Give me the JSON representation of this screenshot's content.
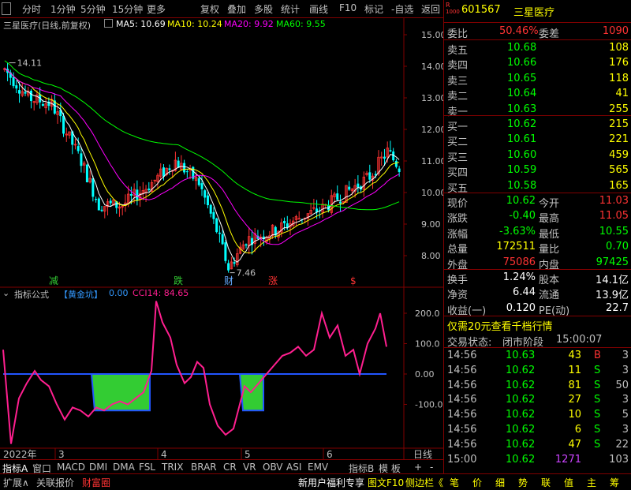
{
  "toolbar": {
    "left": [
      "分时",
      "1分钟",
      "5分钟",
      "15分钟",
      "更多"
    ],
    "right": [
      "复权",
      "叠加",
      "多股",
      "统计",
      "画线",
      "F10",
      "标记",
      "-自选",
      "返回"
    ]
  },
  "main": {
    "title": "三星医疗(日线,前复权)",
    "ma5": "MA5: 10.69",
    "ma10": "MA10: 10.24",
    "ma20": "MA20: 9.92",
    "ma60": "MA60: 9.55",
    "high_label": "14.11",
    "low_label": "7.46",
    "y_ticks": [
      "15.00",
      "14.00",
      "13.00",
      "12.00",
      "11.00",
      "10.00",
      "9.00",
      "8.00"
    ],
    "markers": [
      "减",
      "跌",
      "财",
      "涨",
      "$"
    ]
  },
  "indicator": {
    "title": "指标公式",
    "name": "【黄金坑】",
    "val1": "0.00",
    "cci": "CCI14: 84.65",
    "y_ticks": [
      "200.0",
      "100.0",
      "0.00",
      "-100.0"
    ]
  },
  "xaxis": {
    "year": "2022年",
    "months": [
      "3",
      "4",
      "5",
      "6"
    ],
    "right_label": "日线"
  },
  "tabs": [
    "指标A",
    "窗口",
    "MACD",
    "DMI",
    "DMA",
    "FSL",
    "TRIX",
    "BRAR",
    "CR",
    "VR",
    "OBV",
    "ASI",
    "EMV",
    "指标B",
    "模 板",
    "+",
    "-"
  ],
  "bottom": {
    "left": [
      "扩展∧",
      "关联报价",
      "财富圈"
    ],
    "middle": [
      "新用户福利专享",
      "图文F10",
      "侧边栏《"
    ],
    "right": [
      "笔",
      "价",
      "细",
      "势",
      "联",
      "值",
      "主",
      "筹"
    ]
  },
  "stock": {
    "r_badge": "R",
    "code": "601567",
    "name": "三星医疗"
  },
  "weibi": {
    "label": "委比",
    "value": "50.46%",
    "label2": "委差",
    "value2": "1090"
  },
  "sell": [
    {
      "label": "卖五",
      "price": "10.68",
      "vol": "108"
    },
    {
      "label": "卖四",
      "price": "10.66",
      "vol": "176"
    },
    {
      "label": "卖三",
      "price": "10.65",
      "vol": "118"
    },
    {
      "label": "卖二",
      "price": "10.64",
      "vol": "41"
    },
    {
      "label": "卖一",
      "price": "10.63",
      "vol": "255"
    }
  ],
  "buy": [
    {
      "label": "买一",
      "price": "10.62",
      "vol": "215"
    },
    {
      "label": "买二",
      "price": "10.61",
      "vol": "221"
    },
    {
      "label": "买三",
      "price": "10.60",
      "vol": "459"
    },
    {
      "label": "买四",
      "price": "10.59",
      "vol": "565"
    },
    {
      "label": "买五",
      "price": "10.58",
      "vol": "165"
    }
  ],
  "quote": [
    {
      "l1": "现价",
      "v1": "10.62",
      "l2": "今开",
      "v2": "11.03",
      "c1": "#00ff00",
      "c2": "#ff3333"
    },
    {
      "l1": "涨跌",
      "v1": "-0.40",
      "l2": "最高",
      "v2": "11.05",
      "c1": "#00ff00",
      "c2": "#ff3333"
    },
    {
      "l1": "涨幅",
      "v1": "-3.63%",
      "l2": "最低",
      "v2": "10.55",
      "c1": "#00ff00",
      "c2": "#00ff00"
    },
    {
      "l1": "总量",
      "v1": "172511",
      "l2": "量比",
      "v2": "0.70",
      "c1": "#ffff00",
      "c2": "#00ff00"
    },
    {
      "l1": "外盘",
      "v1": "75086",
      "l2": "内盘",
      "v2": "97425",
      "c1": "#ff3333",
      "c2": "#00ff00"
    }
  ],
  "stats": [
    {
      "l1": "换手",
      "v1": "1.24%",
      "l2": "股本",
      "v2": "14.1亿"
    },
    {
      "l1": "净资",
      "v1": "6.44",
      "l2": "流通",
      "v2": "13.9亿"
    },
    {
      "l1": "收益(一)",
      "v1": "0.120",
      "l2": "PE(动)",
      "v2": "22.7"
    }
  ],
  "promo": "仅需20元查看千档行情",
  "status": {
    "label": "交易状态:",
    "value": "闭市阶段",
    "time": "15:00:07"
  },
  "trades": [
    {
      "time": "14:56",
      "price": "10.63",
      "vol": "43",
      "bs": "B",
      "n": "3"
    },
    {
      "time": "14:56",
      "price": "10.62",
      "vol": "11",
      "bs": "S",
      "n": "3"
    },
    {
      "time": "14:56",
      "price": "10.62",
      "vol": "81",
      "bs": "S",
      "n": "50"
    },
    {
      "time": "14:56",
      "price": "10.62",
      "vol": "27",
      "bs": "S",
      "n": "3"
    },
    {
      "time": "14:56",
      "price": "10.62",
      "vol": "10",
      "bs": "S",
      "n": "5"
    },
    {
      "time": "14:56",
      "price": "10.62",
      "vol": "6",
      "bs": "S",
      "n": "3"
    },
    {
      "time": "14:56",
      "price": "10.62",
      "vol": "47",
      "bs": "S",
      "n": "22"
    },
    {
      "time": "15:00",
      "price": "10.62",
      "vol": "1271",
      "bs": "",
      "n": "103"
    }
  ],
  "colors": {
    "up": "#ff3333",
    "down": "#00ffff",
    "ma5": "#ffffff",
    "ma10": "#ffff00",
    "ma20": "#ff00ff",
    "ma60": "#00ff00",
    "cci": "#ff1f8f",
    "pit": "#33cc33"
  }
}
